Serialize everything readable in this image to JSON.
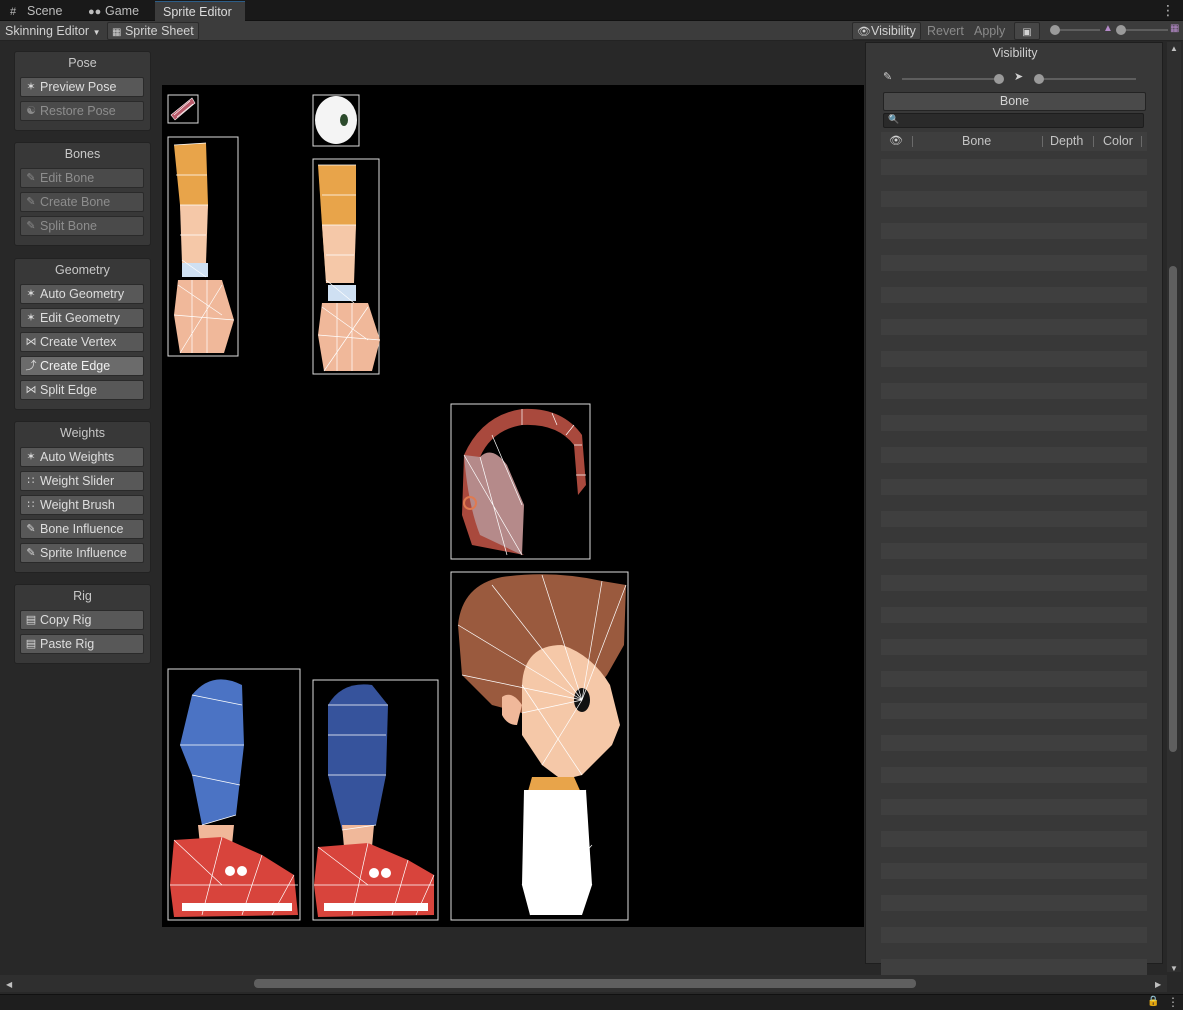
{
  "tabs": [
    {
      "label": "Scene",
      "icon": "grid-icon"
    },
    {
      "label": "Game",
      "icon": "gamepad-icon"
    },
    {
      "label": "Sprite Editor",
      "icon": ""
    }
  ],
  "active_tab": "Sprite Editor",
  "toolbar": {
    "mode_dropdown": "Skinning Editor",
    "sprite_sheet": "Sprite Sheet",
    "visibility": "Visibility",
    "revert": "Revert",
    "apply": "Apply"
  },
  "tool_groups": [
    {
      "title": "Pose",
      "tools": [
        {
          "label": "Preview Pose",
          "icon": "preview-pose-icon",
          "state": "enabled"
        },
        {
          "label": "Restore Pose",
          "icon": "restore-pose-icon",
          "state": "disabled"
        }
      ]
    },
    {
      "title": "Bones",
      "tools": [
        {
          "label": "Edit Bone",
          "icon": "edit-bone-icon",
          "state": "disabled"
        },
        {
          "label": "Create Bone",
          "icon": "create-bone-icon",
          "state": "disabled"
        },
        {
          "label": "Split Bone",
          "icon": "split-bone-icon",
          "state": "disabled"
        }
      ]
    },
    {
      "title": "Geometry",
      "tools": [
        {
          "label": "Auto Geometry",
          "icon": "auto-geometry-icon",
          "state": "enabled"
        },
        {
          "label": "Edit Geometry",
          "icon": "edit-geometry-icon",
          "state": "enabled"
        },
        {
          "label": "Create Vertex",
          "icon": "create-vertex-icon",
          "state": "enabled"
        },
        {
          "label": "Create Edge",
          "icon": "create-edge-icon",
          "state": "active"
        },
        {
          "label": "Split Edge",
          "icon": "split-edge-icon",
          "state": "enabled"
        }
      ]
    },
    {
      "title": "Weights",
      "tools": [
        {
          "label": "Auto Weights",
          "icon": "auto-weights-icon",
          "state": "enabled"
        },
        {
          "label": "Weight Slider",
          "icon": "weight-slider-icon",
          "state": "enabled"
        },
        {
          "label": "Weight Brush",
          "icon": "weight-brush-icon",
          "state": "enabled"
        },
        {
          "label": "Bone Influence",
          "icon": "bone-influence-icon",
          "state": "enabled"
        },
        {
          "label": "Sprite Influence",
          "icon": "sprite-influence-icon",
          "state": "enabled"
        }
      ]
    },
    {
      "title": "Rig",
      "tools": [
        {
          "label": "Copy Rig",
          "icon": "copy-rig-icon",
          "state": "enabled"
        },
        {
          "label": "Paste Rig",
          "icon": "paste-rig-icon",
          "state": "enabled"
        }
      ]
    }
  ],
  "visibility_panel": {
    "title": "Visibility",
    "tab": "Bone",
    "search_value": "",
    "columns": [
      "Bone",
      "Depth",
      "Color"
    ]
  },
  "colors": {
    "background": "#282828",
    "panel": "#383838",
    "button": "#585858",
    "active_tab_accent": "#2c5d87",
    "canvas": "#000000"
  }
}
